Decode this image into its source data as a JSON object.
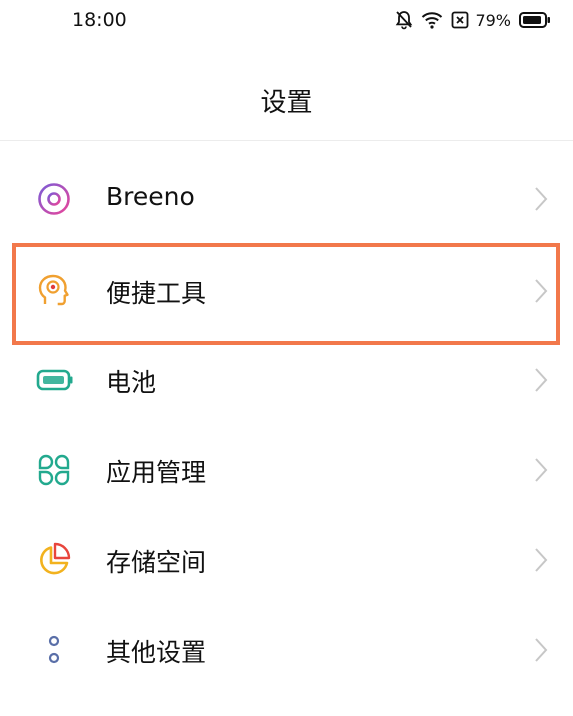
{
  "status_bar": {
    "time": "18:00",
    "battery_percent": "79%",
    "icons": [
      "bell-off-icon",
      "wifi-icon",
      "sim-blocked-icon",
      "battery-icon"
    ]
  },
  "header": {
    "title": "设置"
  },
  "settings": {
    "items": [
      {
        "label": "Breeno",
        "icon": "breeno-icon"
      },
      {
        "label": "便捷工具",
        "icon": "head-tools-icon"
      },
      {
        "label": "电池",
        "icon": "battery-setting-icon"
      },
      {
        "label": "应用管理",
        "icon": "apps-grid-icon"
      },
      {
        "label": "存储空间",
        "icon": "storage-pie-icon"
      },
      {
        "label": "其他设置",
        "icon": "more-dots-icon"
      }
    ]
  },
  "colors": {
    "highlight": "#f2784b",
    "breeno": "#c04ed0",
    "tools": "#f0a030",
    "battery": "#22a98e",
    "apps": "#22a98e",
    "storage": "#f2b21e",
    "more": "#5a6fa8"
  }
}
